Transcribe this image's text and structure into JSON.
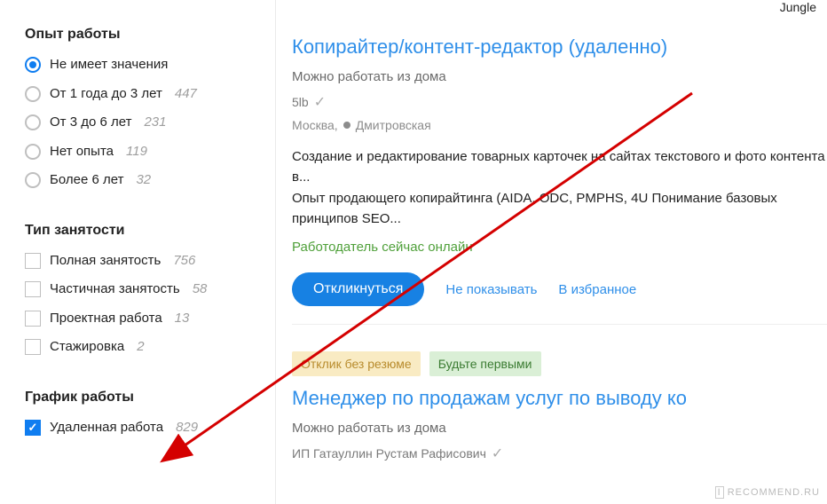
{
  "logo_top": "Jungle",
  "filters": {
    "experience": {
      "heading": "Опыт работы",
      "options": [
        {
          "label": "Не имеет значения",
          "count": "",
          "checked": true
        },
        {
          "label": "От 1 года до 3 лет",
          "count": "447",
          "checked": false
        },
        {
          "label": "От 3 до 6 лет",
          "count": "231",
          "checked": false
        },
        {
          "label": "Нет опыта",
          "count": "119",
          "checked": false
        },
        {
          "label": "Более 6 лет",
          "count": "32",
          "checked": false
        }
      ]
    },
    "employment": {
      "heading": "Тип занятости",
      "options": [
        {
          "label": "Полная занятость",
          "count": "756",
          "checked": false
        },
        {
          "label": "Частичная занятость",
          "count": "58",
          "checked": false
        },
        {
          "label": "Проектная работа",
          "count": "13",
          "checked": false
        },
        {
          "label": "Стажировка",
          "count": "2",
          "checked": false
        }
      ]
    },
    "schedule": {
      "heading": "График работы",
      "options": [
        {
          "label": "Удаленная работа",
          "count": "829",
          "checked": true
        }
      ]
    }
  },
  "cards": {
    "c1": {
      "title": "Копирайтер/контент-редактор (удаленно)",
      "subtitle": "Можно работать из дома",
      "company": "5lb",
      "city": "Москва,",
      "metro": "Дмитровская",
      "desc": "Создание и редактирование товарных карточек на сайтах текстового и фото контента в...\nОпыт продающего копирайтинга (AIDA, ODC, PMPHS, 4U Понимание базовых принципов SEO...",
      "online": "Работодатель сейчас онлайн",
      "apply": "Откликнуться",
      "hide": "Не показывать",
      "fav": "В избранное"
    },
    "c2": {
      "tag1": "Отклик без резюме",
      "tag2": "Будьте первыми",
      "title": "Менеджер по продажам услуг по выводу ко",
      "subtitle": "Можно работать из дома",
      "company": "ИП Гатауллин Рустам Рафисович"
    }
  },
  "watermark": {
    "i": "I",
    "text": "RECOMMEND.RU"
  }
}
